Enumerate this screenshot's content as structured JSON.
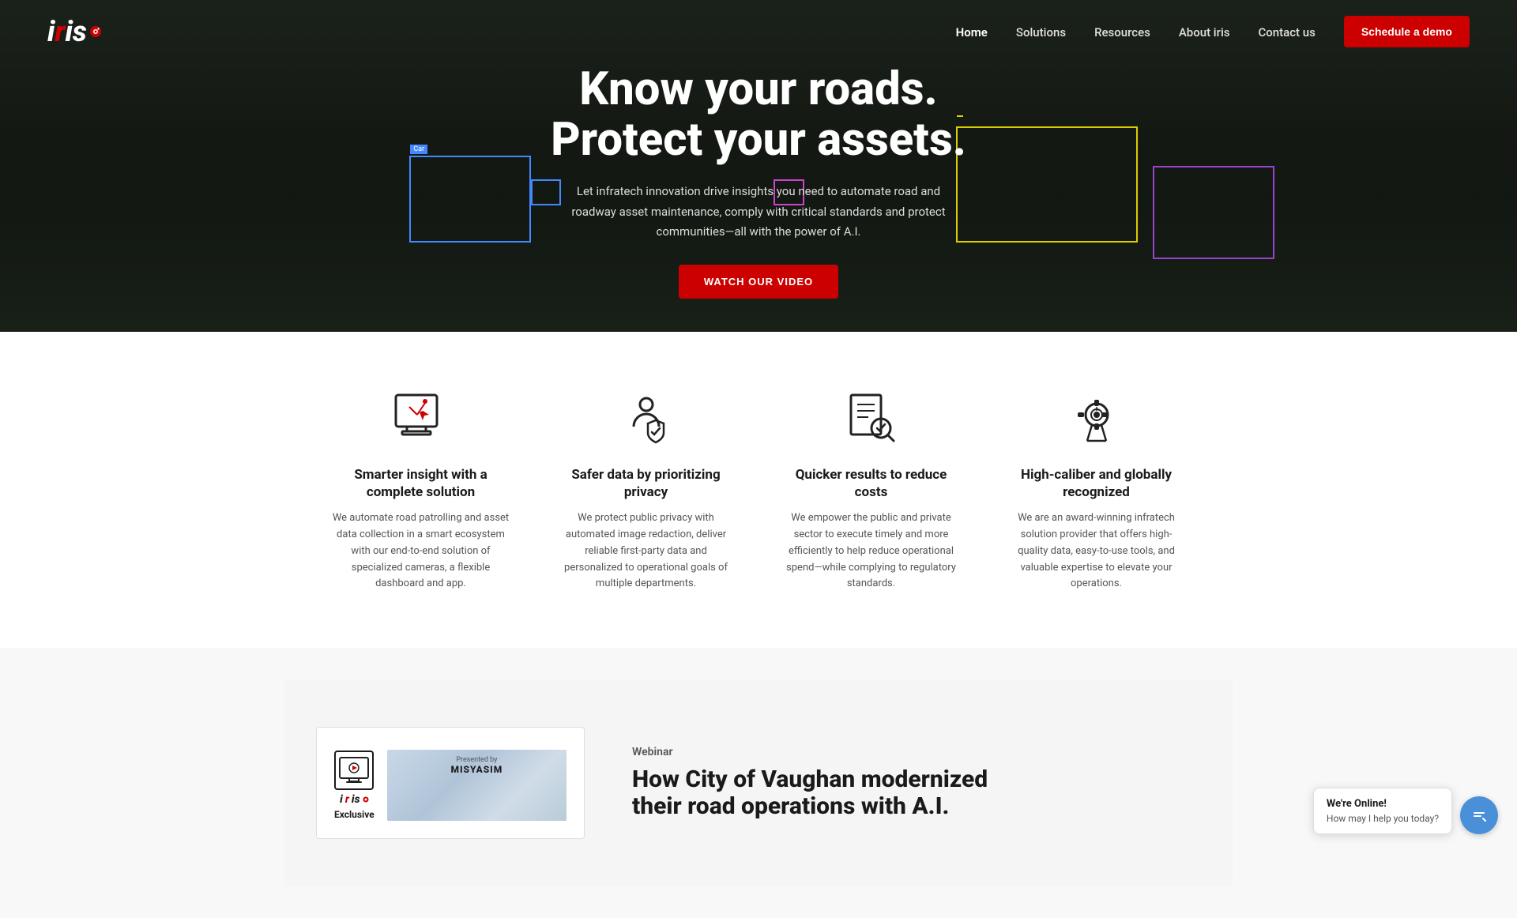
{
  "brand": {
    "name": "iris",
    "logo_text": "iris"
  },
  "navbar": {
    "links": [
      {
        "id": "home",
        "label": "Home",
        "active": true
      },
      {
        "id": "solutions",
        "label": "Solutions",
        "active": false
      },
      {
        "id": "resources",
        "label": "Resources",
        "active": false
      },
      {
        "id": "about",
        "label": "About iris",
        "active": false
      },
      {
        "id": "contact",
        "label": "Contact us",
        "active": false
      }
    ],
    "cta_label": "Schedule a demo"
  },
  "hero": {
    "title_line1": "Know your roads.",
    "title_line2": "Protect your assets.",
    "subtitle": "Let infratech innovation drive insights you need to automate road and roadway asset maintenance, comply with critical standards and protect communities—all with the power of A.I.",
    "cta_label": "WATCH OUR VIDEO"
  },
  "features": {
    "items": [
      {
        "id": "smarter-insight",
        "title": "Smarter insight with a complete solution",
        "desc": "We automate road patrolling and asset data collection in a smart ecosystem with our end-to-end solution of specialized cameras, a flexible dashboard and app."
      },
      {
        "id": "safer-data",
        "title": "Safer data by prioritizing privacy",
        "desc": "We protect public privacy with automated image redaction, deliver reliable first-party data and personalized to operational goals of multiple departments."
      },
      {
        "id": "quicker-results",
        "title": "Quicker results to reduce costs",
        "desc": "We empower the public and private sector to execute timely and more efficiently to help reduce operational spend—while complying to regulatory standards."
      },
      {
        "id": "high-caliber",
        "title": "High-caliber and globally recognized",
        "desc": "We are an award-winning infratech solution provider that offers high-quality data, easy-to-use tools, and valuable expertise to elevate your operations."
      }
    ]
  },
  "webinar": {
    "label": "Webinar",
    "title_line1": "How City of Vaughan modernized",
    "title_line2": "their road operations with A.I."
  },
  "chat": {
    "online_title": "We're Online!",
    "online_sub": "How may I help you today?"
  }
}
